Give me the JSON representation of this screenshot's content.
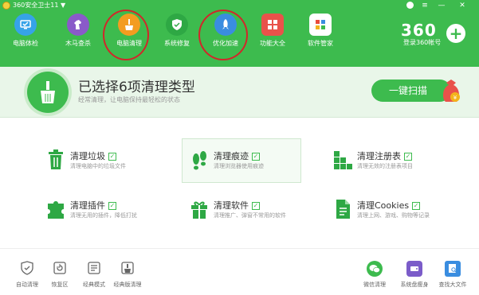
{
  "window": {
    "title": "360安全卫士11 ▼",
    "controls": [
      "skin",
      "menu",
      "minimize",
      "close"
    ]
  },
  "nav": {
    "items": [
      {
        "label": "电脑体检",
        "icon": "monitor-check-icon"
      },
      {
        "label": "木马查杀",
        "icon": "horse-icon"
      },
      {
        "label": "电脑清理",
        "icon": "broom-icon"
      },
      {
        "label": "系统修复",
        "icon": "shield-icon"
      },
      {
        "label": "优化加速",
        "icon": "rocket-icon"
      },
      {
        "label": "功能大全",
        "icon": "grid-icon"
      },
      {
        "label": "软件管家",
        "icon": "apps-icon"
      }
    ],
    "brand": "360",
    "login_label": "登录360帐号",
    "login_icon": "plus-icon"
  },
  "banner": {
    "title": "已选择6项清理类型",
    "subtitle": "经常清理，让电脑保持最轻松的状态",
    "button": "一键扫描"
  },
  "items": [
    {
      "title": "清理垃圾",
      "desc": "清理电脑中的垃圾文件",
      "icon": "trash-icon",
      "checked": true
    },
    {
      "title": "清理痕迹",
      "desc": "清理浏览器使用痕迹",
      "icon": "footprint-icon",
      "checked": true
    },
    {
      "title": "清理注册表",
      "desc": "清理无效的注册表项目",
      "icon": "blocks-icon",
      "checked": true
    },
    {
      "title": "清理插件",
      "desc": "清理无用的插件，降低打扰",
      "icon": "puzzle-icon",
      "checked": true
    },
    {
      "title": "清理软件",
      "desc": "清理推广、弹窗不常用的软件",
      "icon": "gift-box-icon",
      "checked": true
    },
    {
      "title": "清理Cookies",
      "desc": "清理上网、游戏、购物等记录",
      "icon": "document-icon",
      "checked": true
    }
  ],
  "tools_left": [
    {
      "label": "自动清理",
      "icon": "shield-check-icon"
    },
    {
      "label": "恢复区",
      "icon": "restore-icon"
    },
    {
      "label": "经典模式",
      "icon": "classic-mode-icon"
    },
    {
      "label": "经典版清理",
      "icon": "classic-clean-icon"
    }
  ],
  "tools_right": [
    {
      "label": "微信清理",
      "icon": "wechat-icon"
    },
    {
      "label": "系统盘瘦身",
      "icon": "disk-slim-icon"
    },
    {
      "label": "查找大文件",
      "icon": "find-file-icon"
    }
  ],
  "colors": {
    "accent": "#3dbb4e",
    "annotation_ring": "#d2262a",
    "banner_bg": "#e9f6e9"
  }
}
